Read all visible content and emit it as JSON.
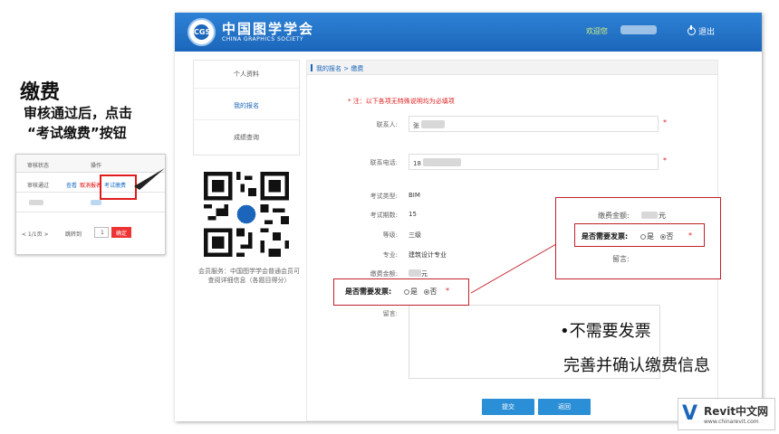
{
  "slide": {
    "title": "缴费",
    "subtitle_line1": "审核通过后，点击",
    "subtitle_line2": "“考试缴费”按钮"
  },
  "mini_table": {
    "col_status": "审核状态",
    "col_action": "操作",
    "status_value": "审核通过",
    "link_view": "查看",
    "link_cancel": "取消报名",
    "link_pay": "考试缴费",
    "pager_text": "< 1/1页 >",
    "jump_label": "跳转到",
    "page_input": "1",
    "confirm_button": "确定"
  },
  "header": {
    "org_name_cn": "中国图学学会",
    "org_name_en": "CHINA GRAPHICS SOCIETY",
    "logo_text": "CGS",
    "welcome": "欢迎您",
    "logout": "退出"
  },
  "sidebar": {
    "items": [
      {
        "label": "个人资料"
      },
      {
        "label": "我的报名"
      },
      {
        "label": "成绩查询"
      }
    ]
  },
  "qr_caption": "会员服务：中国图学学会普通会员可查阅详细信息（各题目得分）",
  "breadcrumb": "我的报名 > 缴费",
  "form": {
    "note": "* 注：以下各项无特殊说明均为必填项",
    "contact_label": "联系人:",
    "contact_value": "张",
    "phone_label": "联系电话:",
    "phone_value": "18",
    "exam_type_label": "考试类型:",
    "exam_type_value": "BIM",
    "exam_period_label": "考试期数:",
    "exam_period_value": "15",
    "level_label": "等级:",
    "level_value": "三级",
    "major_label": "专业:",
    "major_value": "建筑设计专业",
    "fee_label": "缴费金额:",
    "fee_unit": "元",
    "invoice_label": "是否需要发票:",
    "opt_yes": "是",
    "opt_no": "否",
    "remark_label": "留言:",
    "submit": "提交",
    "back": "返回",
    "required_mark": "*"
  },
  "callout": {
    "fee_label": "缴费金额:",
    "fee_unit": "元",
    "invoice_label": "是否需要发票:",
    "opt_yes": "是",
    "opt_no": "否",
    "remark_label": "留言:"
  },
  "notes": {
    "no_invoice": "•不需要发票",
    "confirm": "完善并确认缴费信息"
  },
  "watermark": {
    "brand": "Revit中文网",
    "url": "www.chinarevit.com"
  }
}
